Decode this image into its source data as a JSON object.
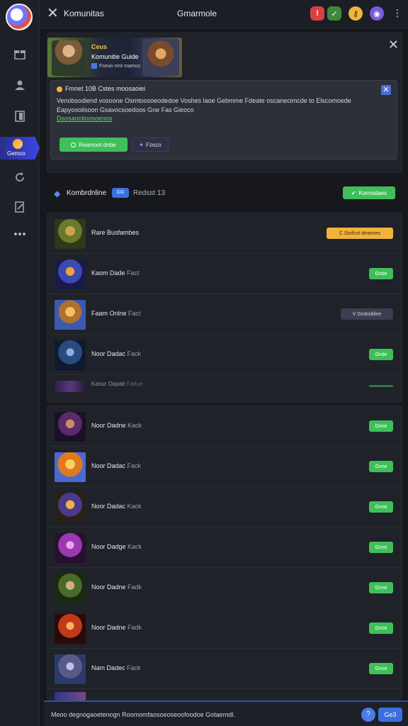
{
  "topbar": {
    "title": "Komunitas",
    "center": "Gmarmole",
    "icons": [
      "alert-icon",
      "shield-icon",
      "key-icon",
      "profile-icon"
    ]
  },
  "rail": {
    "active_label": "Gemco"
  },
  "promo": {
    "banner_tag": "Ceus",
    "banner_title": "Komunitie Guide",
    "banner_sub": "Fseuo mnt mamco",
    "notice_head": "Fmnet 10B Cstes moosaoiei",
    "notice_body": "Venobsodiend vosoone Osmtoosoeodedoe Voshes laoe Gebmme Fdeate oscanecimcde to Elscomoede Eapyosoilsoon Gsavocsoedoos Gne Fas Gieoco",
    "notice_link": "Dsosaoolioosoenos",
    "btn_primary": "Reamoot dnbe",
    "btn_secondary": "Fzezo"
  },
  "list_header": {
    "title": "Kombrdnline",
    "badge": "GG",
    "count": "Redsst 13",
    "action": "Kamsidaes"
  },
  "rows1": [
    {
      "name": "Rare Busfambes",
      "dim": "",
      "action": "C Sorfcot dmemes",
      "kind": "yellow"
    },
    {
      "name": "Kaom Dade",
      "dim": "Fact",
      "action": "Gnbe",
      "kind": "green"
    },
    {
      "name": "Faam Onlne",
      "dim": "Fact",
      "action": "V Grobsiblee",
      "kind": "grey"
    },
    {
      "name": "Noor Dadac",
      "dim": "Fack",
      "action": "Gnde",
      "kind": "green"
    },
    {
      "name": "Kaour Oapab",
      "dim": "Fadue",
      "action": "",
      "kind": "faint"
    }
  ],
  "rows2": [
    {
      "name": "Noor Dadne",
      "dim": "Kack",
      "action": "Gnne"
    },
    {
      "name": "Noor Dadac",
      "dim": "Fack",
      "action": "Gnne"
    },
    {
      "name": "Noor Dadac",
      "dim": "Kack",
      "action": "Gnne"
    },
    {
      "name": "Noor Dadge",
      "dim": "Kack",
      "action": "Gnne"
    },
    {
      "name": "Noor Dadne",
      "dim": "Fadk",
      "action": "Gnne"
    },
    {
      "name": "Noor Dadne",
      "dim": "Fadk",
      "action": "Gnne"
    },
    {
      "name": "Nam Dadec",
      "dim": "Fack",
      "action": "Gnne"
    }
  ],
  "bottombar": {
    "text": "Meoo degnogaoetenogn Roomomfaosoeoseoofoodoe Gotaemdl.",
    "button": "Ge3"
  }
}
